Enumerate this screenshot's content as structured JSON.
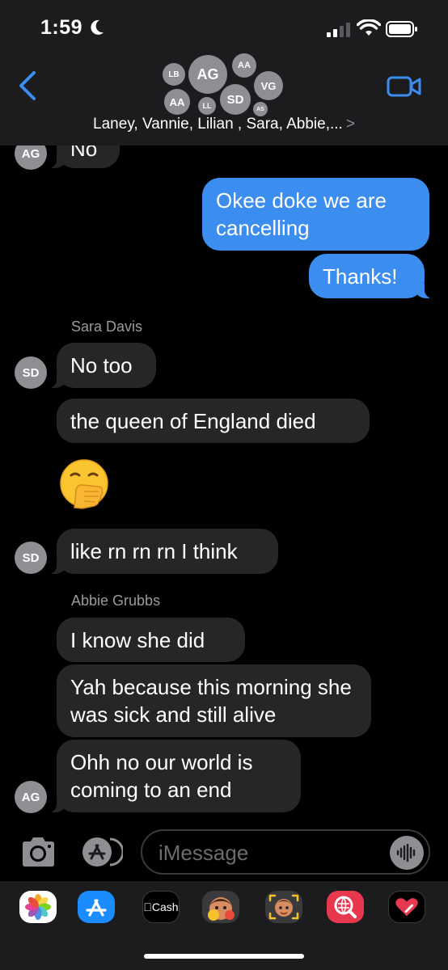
{
  "status": {
    "time": "1:59"
  },
  "header": {
    "avatars": [
      "LB",
      "AG",
      "AA",
      "AA",
      "LL",
      "SD",
      "VG",
      "AS"
    ],
    "title": "Laney, Vannie, Lilian , Sara, Abbie,...",
    "chevron": ">"
  },
  "messages": {
    "m0": {
      "avatar": "AG",
      "text": "No"
    },
    "m1": {
      "text": "Okee doke we are cancelling"
    },
    "m2": {
      "text": "Thanks!"
    },
    "s1": {
      "sender": "Sara Davis"
    },
    "m3": {
      "avatar": "SD",
      "text": "No too"
    },
    "m4": {
      "text": "the queen of England died"
    },
    "m5": {
      "emoji": "🤭"
    },
    "m6": {
      "avatar": "SD",
      "text": "like rn rn rn I think"
    },
    "s2": {
      "sender": "Abbie Grubbs"
    },
    "m7": {
      "text": "I know she did"
    },
    "m8": {
      "text": "Yah because this morning she was sick and still alive"
    },
    "m9": {
      "avatar": "AG",
      "text": "Ohh no our world is coming to an end"
    }
  },
  "input": {
    "placeholder": "iMessage"
  },
  "drawer": {
    "apps": [
      "photos-app",
      "app-store-app",
      "apple-cash-app",
      "memoji-stickers-app",
      "animoji-app",
      "web-images-app",
      "digital-touch-app"
    ],
    "cash_label": "Cash"
  },
  "colors": {
    "outgoing": "#3b8ef0",
    "incoming": "#262628",
    "header": "#1c1c1e",
    "avatar": "#8e8e93"
  }
}
